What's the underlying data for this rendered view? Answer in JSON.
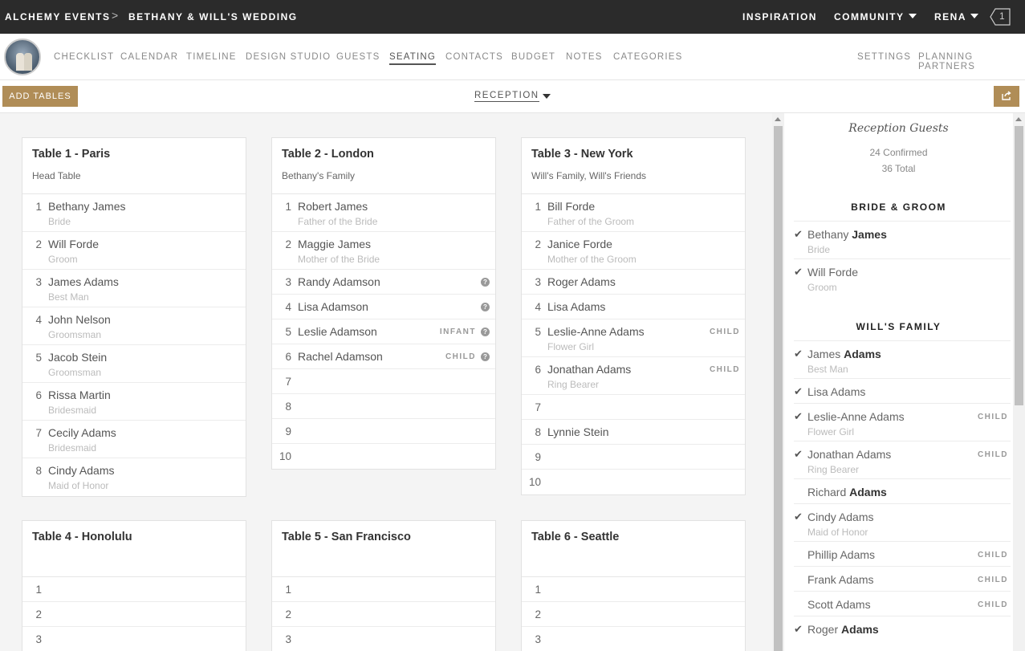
{
  "topbar": {
    "brand": "ALCHEMY EVENTS",
    "separator": ">",
    "event": "BETHANY & WILL'S WEDDING",
    "nav": [
      "INSPIRATION",
      "COMMUNITY",
      "RENA"
    ],
    "notification_count": "1"
  },
  "subnav": {
    "items": [
      "CHECKLIST",
      "CALENDAR",
      "TIMELINE",
      "DESIGN STUDIO",
      "GUESTS",
      "SEATING",
      "CONTACTS",
      "BUDGET",
      "NOTES",
      "CATEGORIES"
    ],
    "active": "SEATING",
    "right": [
      "SETTINGS",
      "PLANNING PARTNERS"
    ]
  },
  "toolbar": {
    "add_tables": "ADD TABLES",
    "event_select": "RECEPTION"
  },
  "tables": [
    {
      "name": "Table 1 - Paris",
      "description": "Head Table",
      "seats": [
        {
          "num": "1",
          "name": "Bethany James",
          "role": "Bride"
        },
        {
          "num": "2",
          "name": "Will Forde",
          "role": "Groom"
        },
        {
          "num": "3",
          "name": "James Adams",
          "role": "Best Man"
        },
        {
          "num": "4",
          "name": "John Nelson",
          "role": "Groomsman"
        },
        {
          "num": "5",
          "name": "Jacob Stein",
          "role": "Groomsman"
        },
        {
          "num": "6",
          "name": "Rissa Martin",
          "role": "Bridesmaid"
        },
        {
          "num": "7",
          "name": "Cecily Adams",
          "role": "Bridesmaid"
        },
        {
          "num": "8",
          "name": "Cindy Adams",
          "role": "Maid of Honor"
        }
      ]
    },
    {
      "name": "Table 2 - London",
      "description": "Bethany's Family",
      "seats": [
        {
          "num": "1",
          "name": "Robert James",
          "role": "Father of the Bride"
        },
        {
          "num": "2",
          "name": "Maggie James",
          "role": "Mother of the Bride"
        },
        {
          "num": "3",
          "name": "Randy Adamson",
          "role": "",
          "badge": "",
          "question": true
        },
        {
          "num": "4",
          "name": "Lisa Adamson",
          "role": "",
          "badge": "",
          "question": true
        },
        {
          "num": "5",
          "name": "Leslie Adamson",
          "role": "",
          "badge": "INFANT",
          "question": true
        },
        {
          "num": "6",
          "name": "Rachel Adamson",
          "role": "",
          "badge": "CHILD",
          "question": true
        },
        {
          "num": "7",
          "name": ""
        },
        {
          "num": "8",
          "name": ""
        },
        {
          "num": "9",
          "name": ""
        },
        {
          "num": "10",
          "name": ""
        }
      ]
    },
    {
      "name": "Table 3 - New York",
      "description": "Will's Family, Will's Friends",
      "seats": [
        {
          "num": "1",
          "name": "Bill Forde",
          "role": "Father of the Groom"
        },
        {
          "num": "2",
          "name": "Janice Forde",
          "role": "Mother of the Groom"
        },
        {
          "num": "3",
          "name": "Roger Adams",
          "role": ""
        },
        {
          "num": "4",
          "name": "Lisa Adams",
          "role": ""
        },
        {
          "num": "5",
          "name": "Leslie-Anne Adams",
          "role": "Flower Girl",
          "badge": "CHILD"
        },
        {
          "num": "6",
          "name": "Jonathan Adams",
          "role": "Ring Bearer",
          "badge": "CHILD"
        },
        {
          "num": "7",
          "name": ""
        },
        {
          "num": "8",
          "name": "Lynnie Stein",
          "role": ""
        },
        {
          "num": "9",
          "name": ""
        },
        {
          "num": "10",
          "name": ""
        }
      ]
    },
    {
      "name": "Table 4 - Honolulu",
      "description": "",
      "seats": [
        {
          "num": "1",
          "name": ""
        },
        {
          "num": "2",
          "name": ""
        },
        {
          "num": "3",
          "name": ""
        }
      ]
    },
    {
      "name": "Table 5 - San Francisco",
      "description": "",
      "seats": [
        {
          "num": "1",
          "name": ""
        },
        {
          "num": "2",
          "name": ""
        },
        {
          "num": "3",
          "name": ""
        }
      ]
    },
    {
      "name": "Table 6 - Seattle",
      "description": "",
      "seats": [
        {
          "num": "1",
          "name": ""
        },
        {
          "num": "2",
          "name": ""
        },
        {
          "num": "3",
          "name": ""
        }
      ]
    }
  ],
  "sidebar": {
    "title": "Reception Guests",
    "confirmed": "24 Confirmed",
    "total": "36 Total",
    "sections": [
      {
        "title": "BRIDE & GROOM",
        "guests": [
          {
            "first": "Bethany",
            "last": "James",
            "role": "Bride",
            "checked": true
          },
          {
            "first": "Will Forde",
            "last": "",
            "role": "Groom",
            "checked": true
          }
        ]
      },
      {
        "title": "WILL'S FAMILY",
        "guests": [
          {
            "first": "James",
            "last": "Adams",
            "role": "Best Man",
            "checked": true
          },
          {
            "first": "Lisa Adams",
            "last": "",
            "role": "",
            "checked": true
          },
          {
            "first": "Leslie-Anne Adams",
            "last": "",
            "role": "Flower Girl",
            "checked": true,
            "badge": "CHILD"
          },
          {
            "first": "Jonathan Adams",
            "last": "",
            "role": "Ring Bearer",
            "checked": true,
            "badge": "CHILD"
          },
          {
            "first": "Richard",
            "last": "Adams",
            "role": "",
            "checked": false
          },
          {
            "first": "Cindy Adams",
            "last": "",
            "role": "Maid of Honor",
            "checked": true
          },
          {
            "first": "Phillip Adams",
            "last": "",
            "role": "",
            "checked": false,
            "badge": "CHILD"
          },
          {
            "first": "Frank Adams",
            "last": "",
            "role": "",
            "checked": false,
            "badge": "CHILD"
          },
          {
            "first": "Scott Adams",
            "last": "",
            "role": "",
            "checked": false,
            "badge": "CHILD"
          },
          {
            "first": "Roger",
            "last": "Adams",
            "role": "",
            "checked": true
          }
        ]
      }
    ]
  },
  "colors": {
    "topbar": "#2b2b2b",
    "accent": "#b08d57",
    "main_bg": "#f4f4f4"
  }
}
